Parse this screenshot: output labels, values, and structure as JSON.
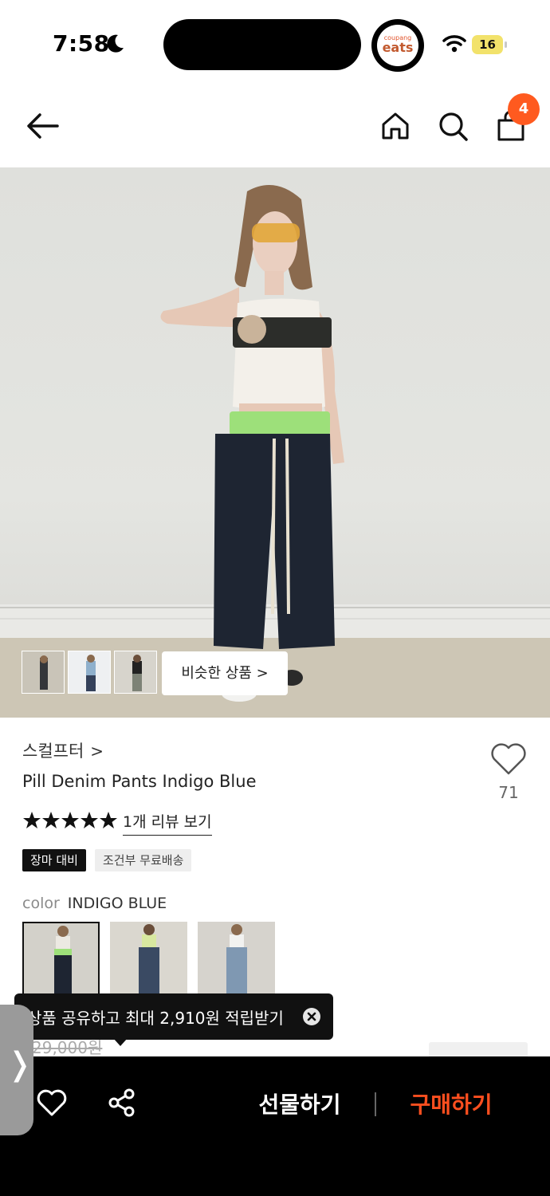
{
  "status_bar": {
    "time": "7:58",
    "eats_small": "coupang",
    "eats_big": "eats",
    "battery": "16"
  },
  "nav": {
    "cart_count": "4"
  },
  "gallery": {
    "similar_button": "비슷한 상품 >",
    "thumbnails": 3
  },
  "product": {
    "brand": "스컬프터",
    "brand_chevron": ">",
    "name": "Pill Denim Pants Indigo Blue",
    "wish_count": "71",
    "rating_stars": 5,
    "review_link": "1개 리뷰 보기",
    "badges": [
      "장마 대비",
      "조건부 무료배송"
    ],
    "color_label": "color",
    "color_value": "INDIGO BLUE",
    "old_price": "29,000원"
  },
  "tooltip": {
    "text": "상품 공유하고 최대 2,910원 적립받기"
  },
  "bottom_bar": {
    "gift_label": "선물하기",
    "buy_label": "구매하기"
  },
  "colors": {
    "accent": "#ff5a1f",
    "buy": "#ff4f1f",
    "bar": "#000000"
  }
}
